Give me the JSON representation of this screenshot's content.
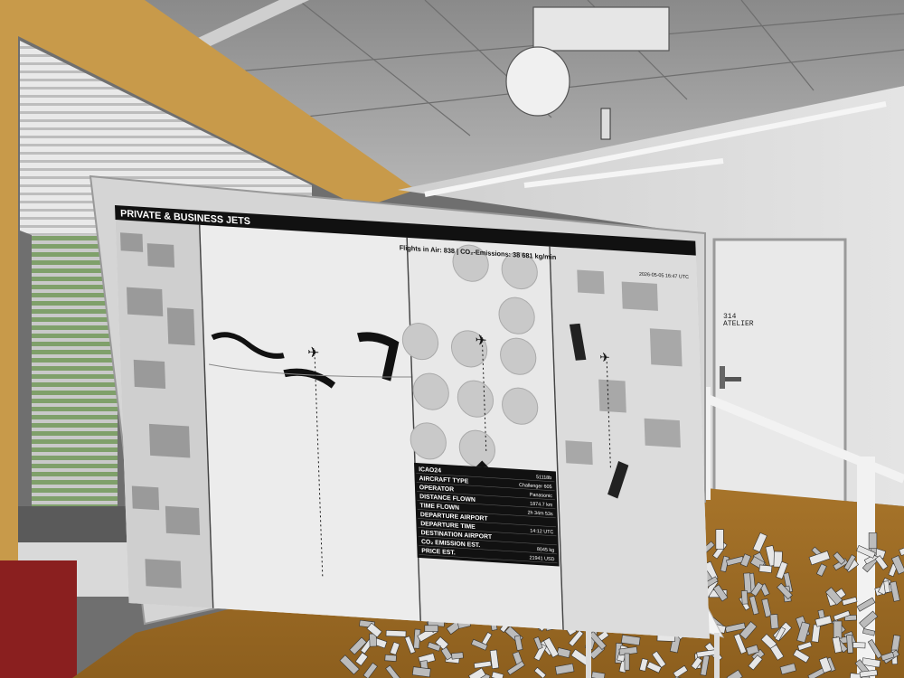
{
  "display": {
    "title": "PRIVATE & BUSINESS JETS",
    "stats": "Flights in Air: 838 | CO₂-Emissions: 38 681 kg/min",
    "timestamp": "2026-05-05 16:47 UTC"
  },
  "info_panel": {
    "rows": [
      {
        "label": "ICAO24",
        "value": "51118b"
      },
      {
        "label": "AIRCRAFT TYPE",
        "value": "Challenger 605"
      },
      {
        "label": "OPERATOR",
        "value": "Panasonic"
      },
      {
        "label": "DISTANCE FLOWN",
        "value": "1874.7 km"
      },
      {
        "label": "TIME FLOWN",
        "value": "2h 34m 53s"
      },
      {
        "label": "DEPARTURE AIRPORT",
        "value": ""
      },
      {
        "label": "DEPARTURE TIME",
        "value": "14:12 UTC"
      },
      {
        "label": "DESTINATION AIRPORT",
        "value": ""
      },
      {
        "label": "CO₂ EMISSION EST.",
        "value": "8045 kg"
      },
      {
        "label": "PRICE EST.",
        "value": "21941 USD"
      }
    ]
  },
  "door_sign": {
    "number": "314",
    "name": "ATELIER"
  },
  "colors": {
    "floor": "#b07a2a",
    "window_frame": "#c89a4a",
    "screen_bg": "#ececec",
    "header": "#111111"
  }
}
